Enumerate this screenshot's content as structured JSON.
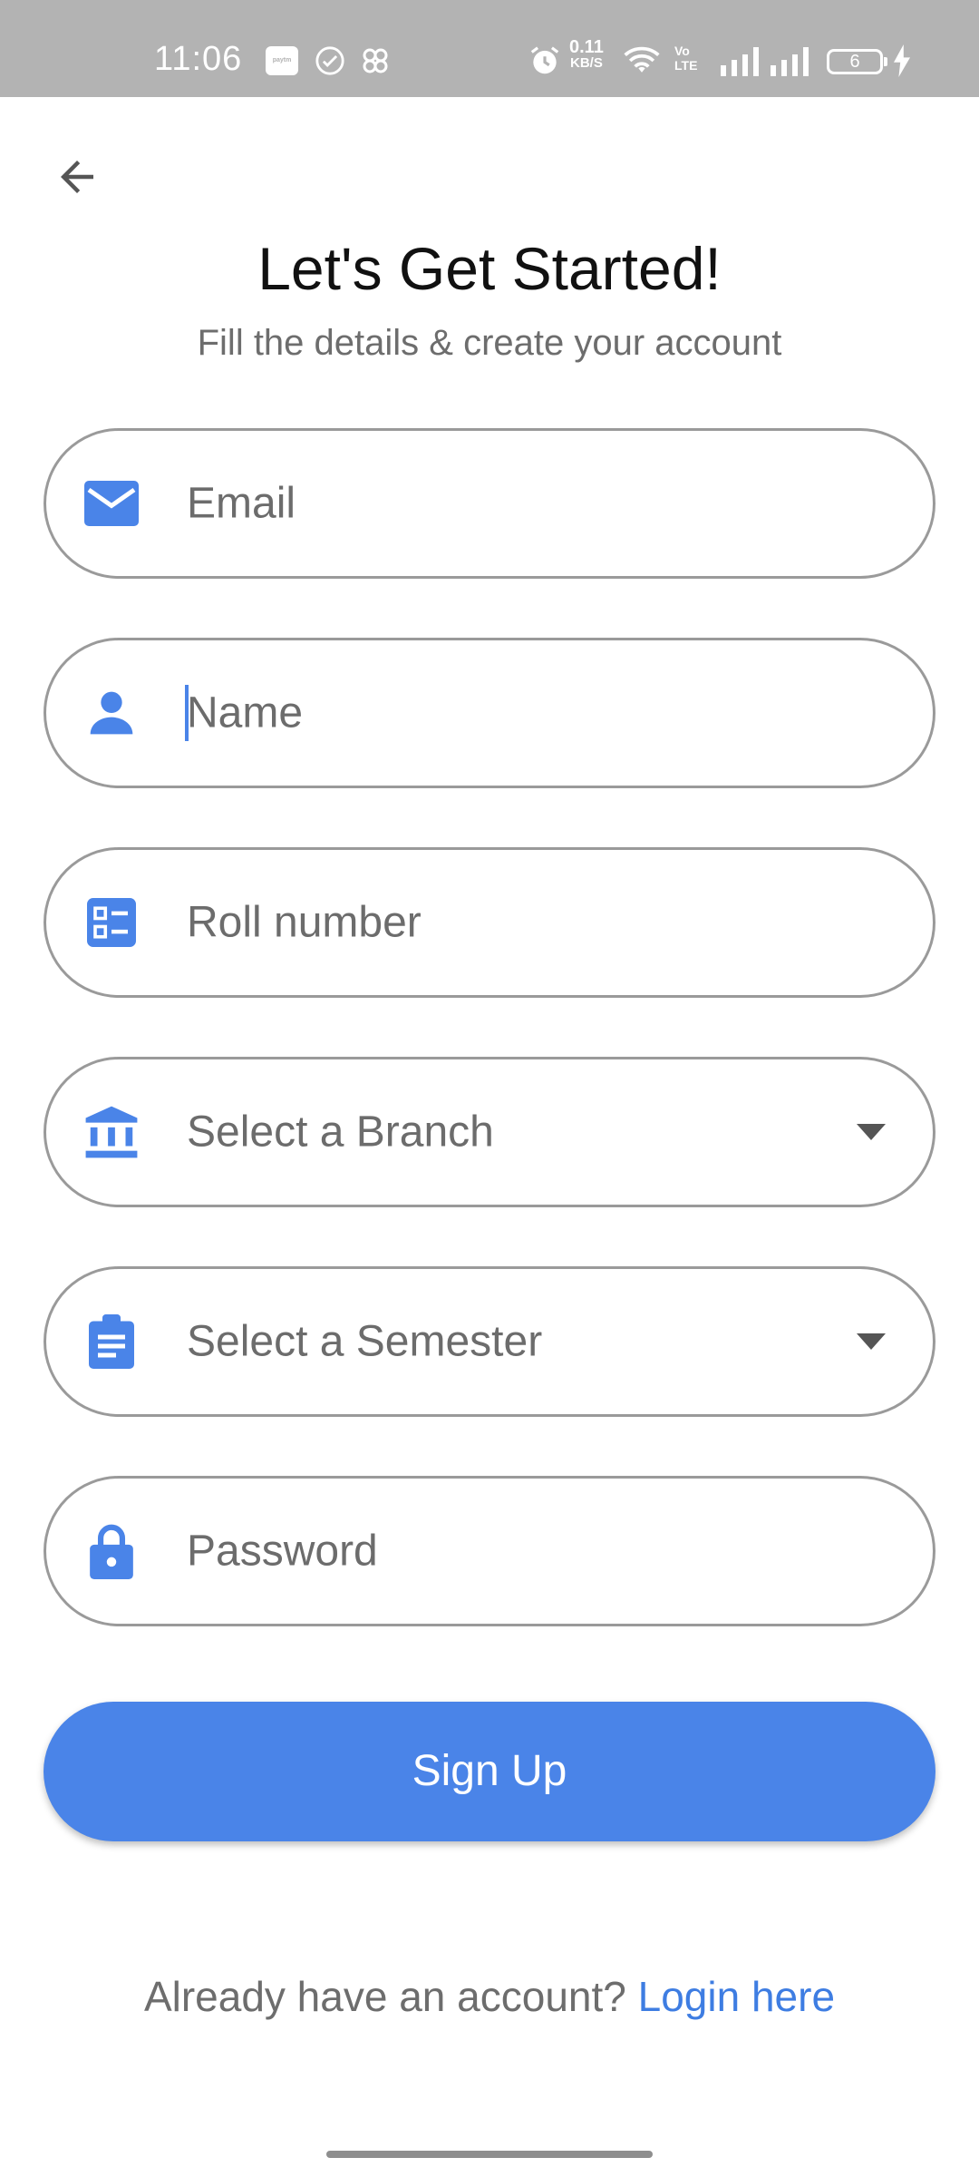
{
  "status_bar": {
    "time": "11:06",
    "paytm": "paytm",
    "speed_value": "0.11",
    "speed_unit": "KB/S",
    "volte": "Vo LTE",
    "battery": "6"
  },
  "header": {
    "back_icon": "arrow-back-icon",
    "title": "Let's Get Started!",
    "subtitle": "Fill the details & create your account"
  },
  "form": {
    "email": {
      "placeholder": "Email",
      "icon": "email-icon"
    },
    "name": {
      "placeholder": "Name",
      "icon": "person-icon"
    },
    "roll": {
      "placeholder": "Roll number",
      "icon": "list-icon"
    },
    "branch": {
      "placeholder": "Select a Branch",
      "icon": "bank-icon"
    },
    "semester": {
      "placeholder": "Select a Semester",
      "icon": "clipboard-icon"
    },
    "password": {
      "placeholder": "Password",
      "icon": "lock-icon"
    },
    "submit_label": "Sign Up"
  },
  "footer": {
    "prompt": "Already have an account? ",
    "login_link": "Login here"
  },
  "colors": {
    "accent": "#4a84e8",
    "link": "#3e7de2",
    "statusbar": "#b3b3b3"
  }
}
